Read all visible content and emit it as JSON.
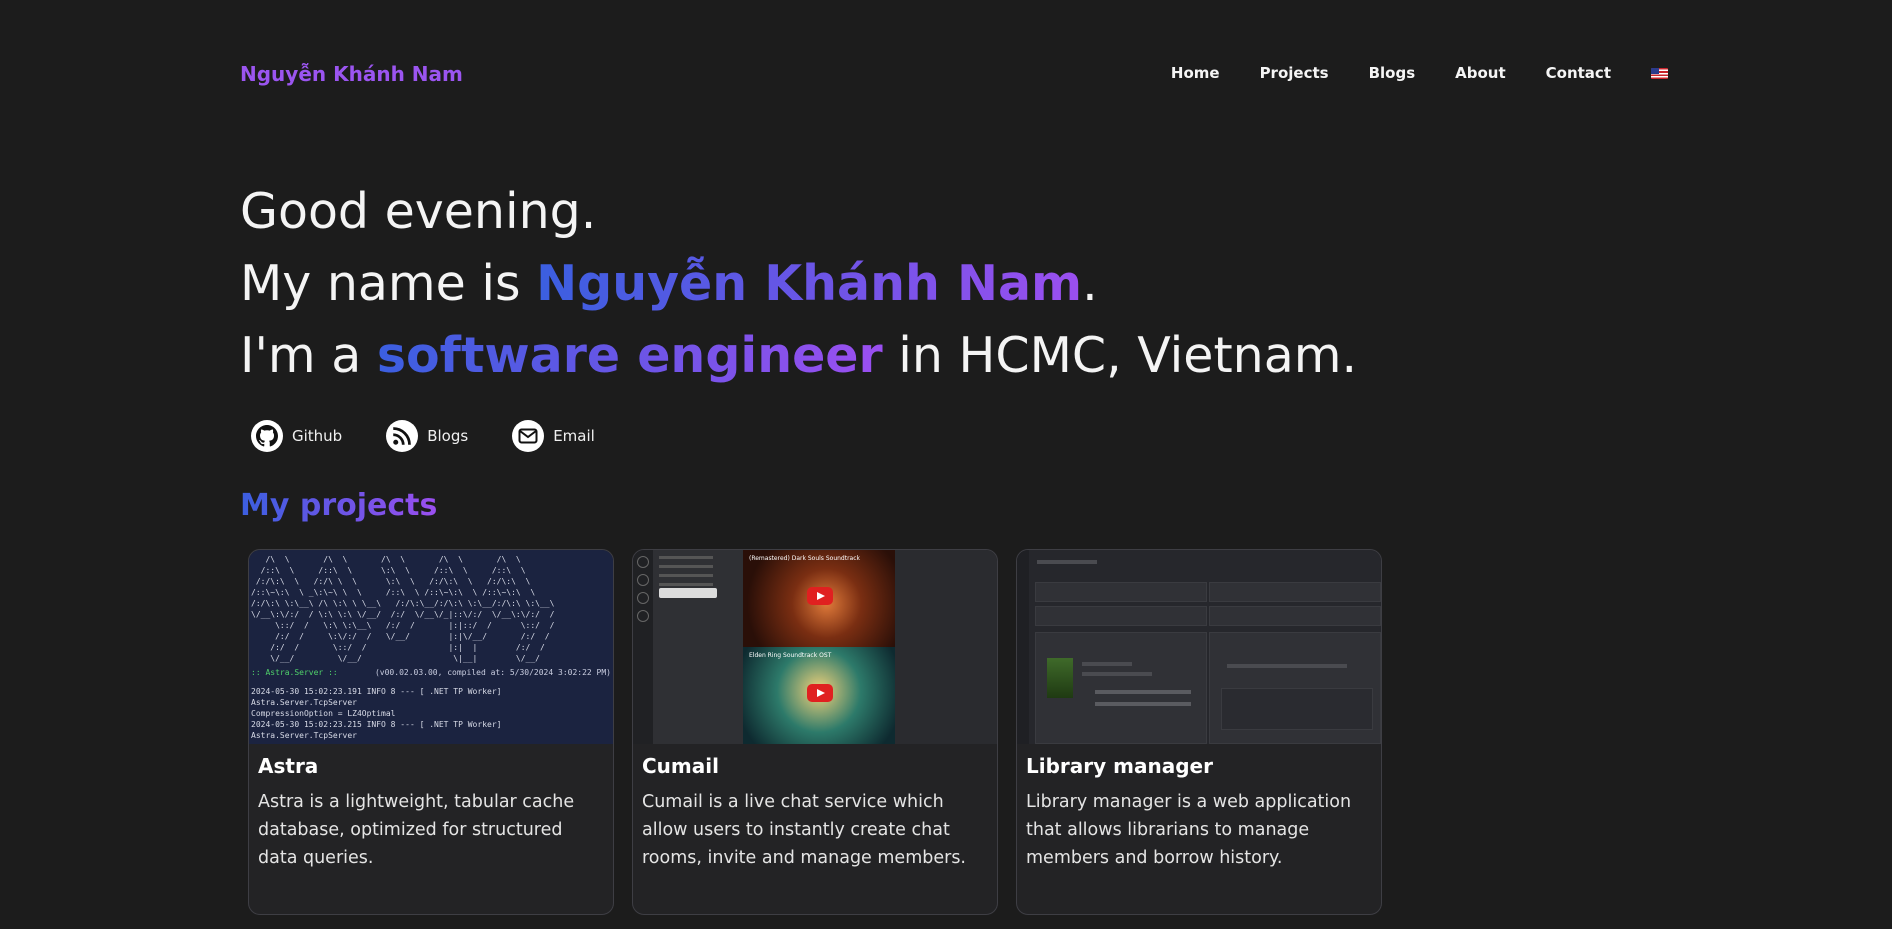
{
  "header": {
    "brand": "Nguyễn Khánh Nam",
    "nav": [
      "Home",
      "Projects",
      "Blogs",
      "About",
      "Contact"
    ],
    "language_flag": "us-flag-icon"
  },
  "hero": {
    "greeting": "Good evening.",
    "name_prefix": "My name is ",
    "name": "Nguyễn Khánh Nam",
    "name_suffix": ".",
    "role_prefix": "I'm a ",
    "role": "software engineer",
    "role_suffix": " in HCMC, Vietnam."
  },
  "social_links": [
    {
      "label": "Github",
      "icon": "github-icon"
    },
    {
      "label": "Blogs",
      "icon": "rss-icon"
    },
    {
      "label": "Email",
      "icon": "mail-icon"
    }
  ],
  "projects": {
    "title": "My projects",
    "items": [
      {
        "title": "Astra",
        "description": "Astra is a lightweight, tabular cache database, optimized for structured data queries."
      },
      {
        "title": "Cumail",
        "description": "Cumail is a live chat service which allow users to instantly create chat rooms, invite and manage members."
      },
      {
        "title": "Library manager",
        "description": "Library manager is a web application that allows librarians to manage members and borrow history."
      }
    ]
  },
  "astra_terminal": {
    "server_label": ":: Astra.Server ::",
    "version": "(v00.02.03.00, compiled at: 5/30/2024 3:02:22 PM)",
    "log_lines": [
      "2024-05-30 15:02:23.191  INFO 8    --- [        .NET TP Worker] Astra.Server.TcpServer",
      " CompressionOption = LZ4Optimal",
      "2024-05-30 15:02:23.215  INFO 8    --- [        .NET TP Worker] Astra.Server.TcpServer"
    ]
  },
  "cumail_preview": {
    "video1": "(Remastered) Dark Souls Soundtrack",
    "video2": "Elden Ring Soundtrack OST"
  },
  "colors": {
    "background": "#1c1c1c",
    "accent_blue": "#3b5fe0",
    "accent_purple": "#9b4ff0"
  }
}
